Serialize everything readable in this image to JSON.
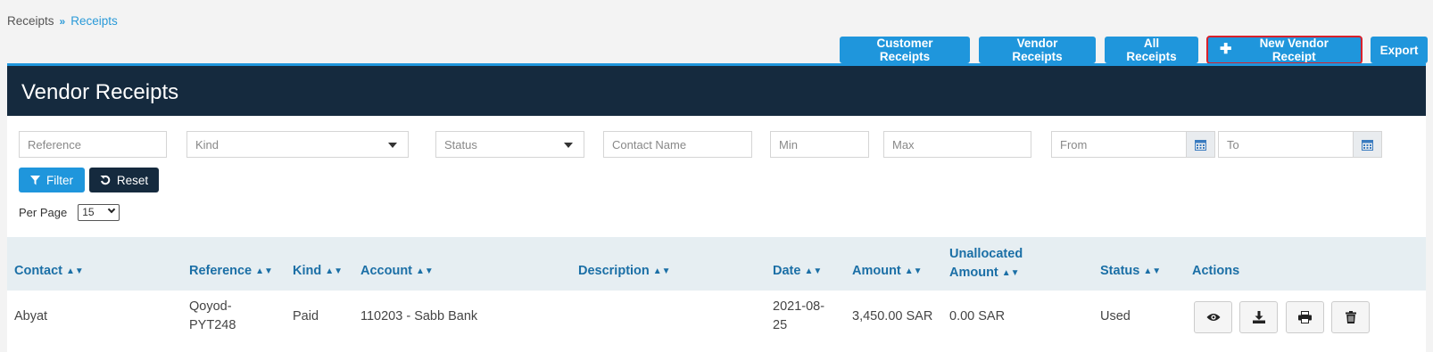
{
  "breadcrumb": {
    "parent": "Receipts",
    "separator": "»",
    "current": "Receipts"
  },
  "top_actions": {
    "customer_receipts": "Customer Receipts",
    "vendor_receipts": "Vendor Receipts",
    "all_receipts": "All Receipts",
    "new_vendor_receipt": "New Vendor Receipt",
    "export": "Export"
  },
  "panel": {
    "title": "Vendor Receipts"
  },
  "filters": {
    "reference_placeholder": "Reference",
    "kind_placeholder": "Kind",
    "status_placeholder": "Status",
    "contact_placeholder": "Contact Name",
    "min_placeholder": "Min",
    "max_placeholder": "Max",
    "from_placeholder": "From",
    "to_placeholder": "To",
    "filter_label": "Filter",
    "reset_label": "Reset",
    "per_page_label": "Per Page",
    "per_page_value": "15"
  },
  "table": {
    "headers": {
      "contact": "Contact",
      "reference": "Reference",
      "kind": "Kind",
      "account": "Account",
      "description": "Description",
      "date": "Date",
      "amount": "Amount",
      "unallocated_1": "Unallocated",
      "unallocated_2": "Amount",
      "status": "Status",
      "actions": "Actions"
    },
    "rows": [
      {
        "contact": "Abyat",
        "reference_1": "Qoyod-",
        "reference_2": "PYT248",
        "kind": "Paid",
        "account": "110203 - Sabb Bank",
        "description": "",
        "date_1": "2021-08-",
        "date_2": "25",
        "amount": "3,450.00 SAR",
        "unallocated": "0.00 SAR",
        "status": "Used"
      }
    ]
  },
  "colors": {
    "primary": "#1f96dc",
    "dark": "#152a3e",
    "header_bg": "#e6eef2",
    "highlight": "#d8202b"
  }
}
